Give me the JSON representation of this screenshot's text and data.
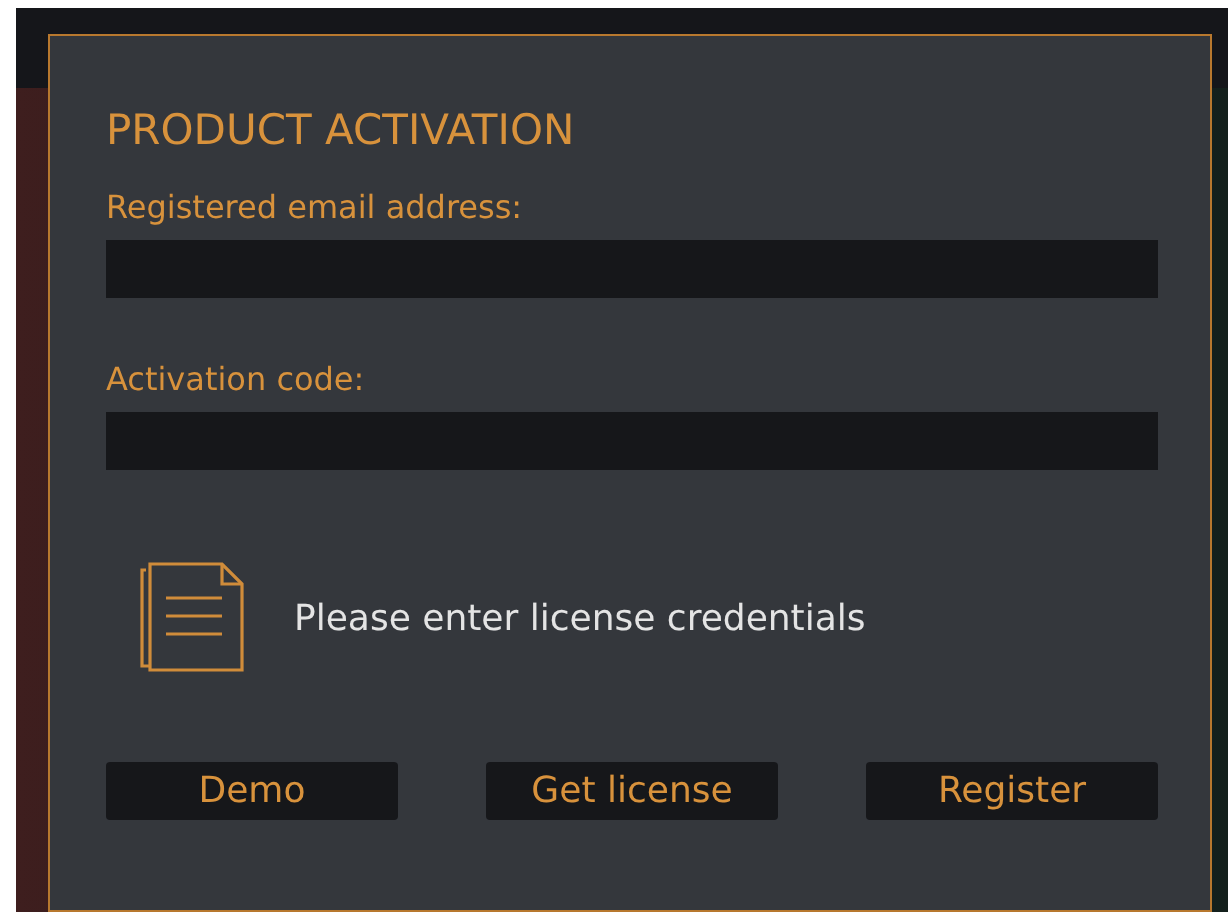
{
  "dialog": {
    "title": "PRODUCT ACTIVATION",
    "fields": [
      {
        "label": "Registered email address:"
      },
      {
        "label": "Activation code:"
      }
    ],
    "message": "Please enter license credentials",
    "buttons": [
      "Demo",
      "Get license",
      "Register"
    ]
  }
}
